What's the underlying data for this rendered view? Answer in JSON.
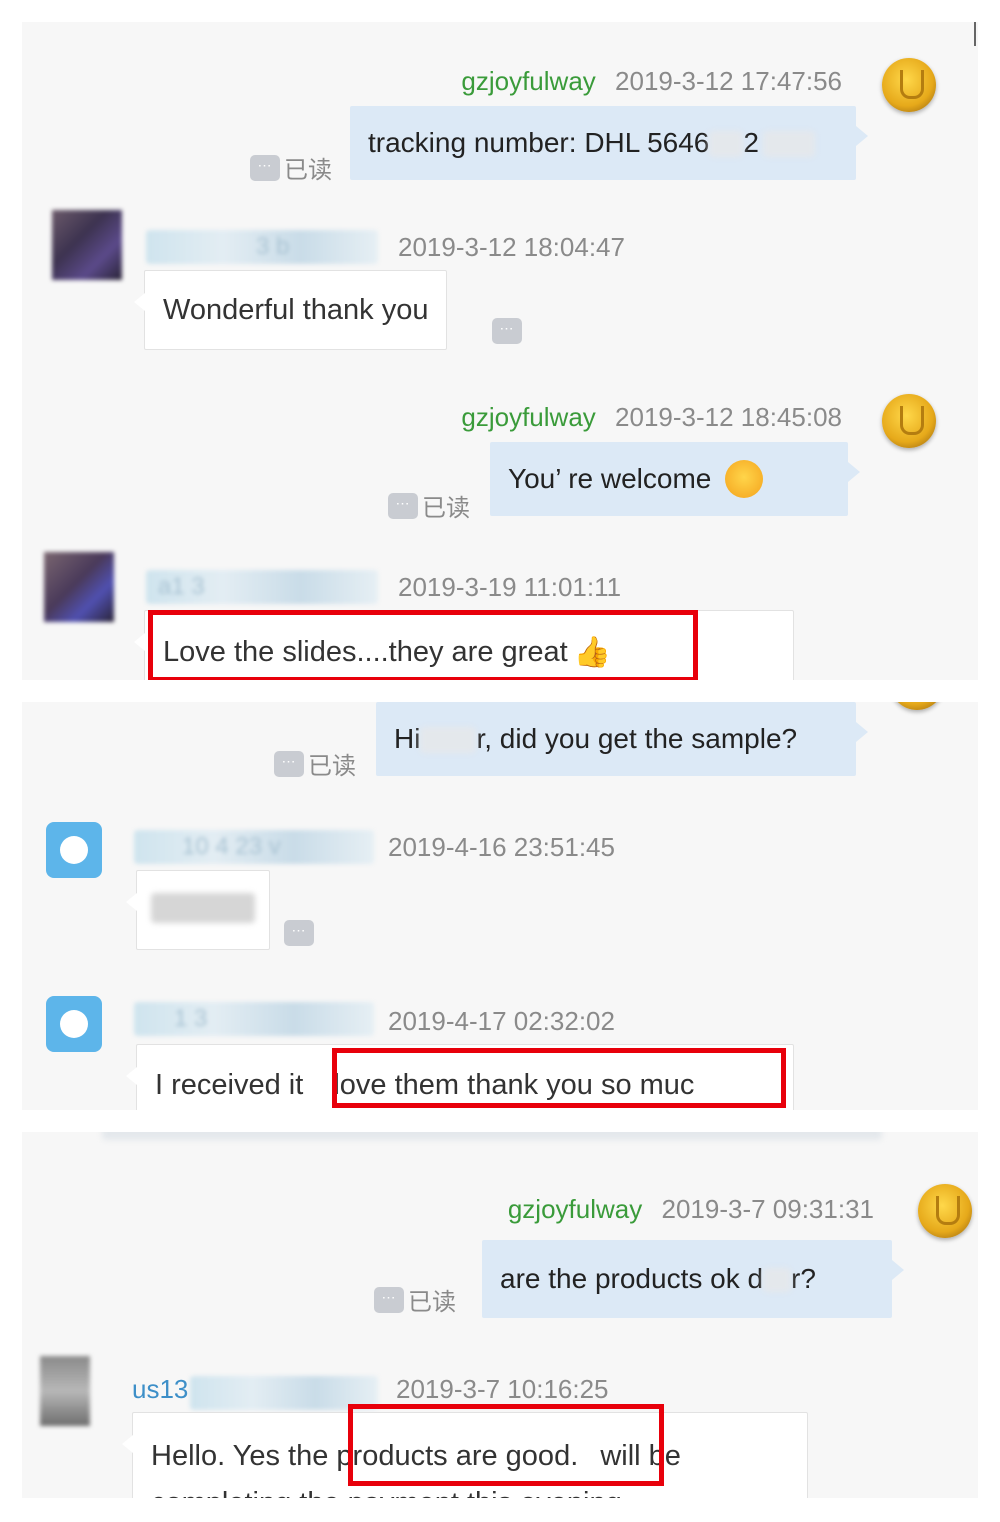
{
  "panel1": {
    "messages": [
      {
        "sender": "gzjoyfulway",
        "time": "2019-3-12 17:47:56",
        "text": "tracking number: DHL 5646",
        "text_tail": "2",
        "read": "已读"
      },
      {
        "sender_partial": "3   b",
        "time": "2019-3-12 18:04:47",
        "text": "Wonderful thank you"
      },
      {
        "sender": "gzjoyfulway",
        "time": "2019-3-12 18:45:08",
        "text": "You’ re welcome",
        "read": "已读"
      },
      {
        "sender_partial": "a1     3",
        "time": "2019-3-19 11:01:11",
        "text": "Love the slides....they are great"
      }
    ]
  },
  "panel2": {
    "messages": [
      {
        "text_pre": "Hi",
        "text_post": "r, did you get the sample?",
        "read": "已读"
      },
      {
        "sender_partial": "10    4    23   v",
        "time": "2019-4-16 23:51:45"
      },
      {
        "sender_partial": "1   3",
        "time": "2019-4-17 02:32:02",
        "text_pre": "I received it",
        "text_highlight": "love them thank you so muc"
      }
    ]
  },
  "panel3": {
    "messages": [
      {
        "sender": "gzjoyfulway",
        "time": "2019-3-7 09:31:31",
        "text_pre": "are the products ok d",
        "text_post": "r?",
        "read": "已读"
      },
      {
        "sender_partial": "us13",
        "time": "2019-3-7 10:16:25",
        "text_pre": "Hello. Yes the",
        "text_highlight": "products are good.",
        "text_post": "will be",
        "text_next_line": "completing the payment this evening"
      }
    ]
  },
  "icons": {
    "more": "⋯",
    "smiley": "smiley-icon",
    "thumbs_up": "👍"
  },
  "colors": {
    "sender_green": "#3a9b3a",
    "outgoing_bubble": "#dce9f6",
    "highlight_red": "#e8000b"
  }
}
